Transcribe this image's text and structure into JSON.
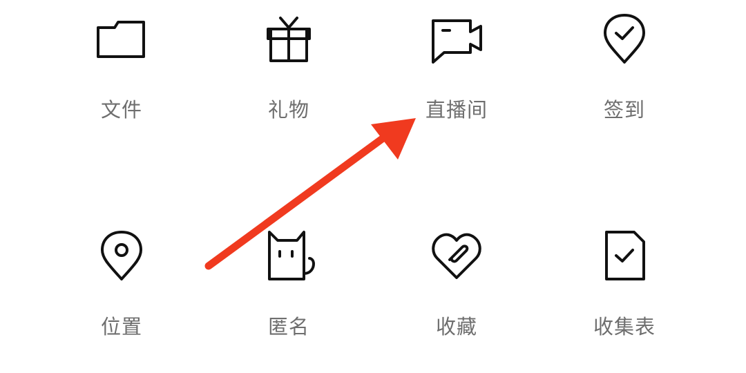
{
  "menu": {
    "items": [
      {
        "label": "文件",
        "icon": "folder-icon"
      },
      {
        "label": "礼物",
        "icon": "gift-icon"
      },
      {
        "label": "直播间",
        "icon": "live-room-icon"
      },
      {
        "label": "签到",
        "icon": "check-in-icon"
      },
      {
        "label": "位置",
        "icon": "location-icon"
      },
      {
        "label": "匿名",
        "icon": "anonymous-cat-icon"
      },
      {
        "label": "收藏",
        "icon": "favorite-icon"
      },
      {
        "label": "收集表",
        "icon": "form-icon"
      }
    ]
  },
  "annotation": {
    "arrow_color": "#f03a1f",
    "target": "直播间"
  }
}
